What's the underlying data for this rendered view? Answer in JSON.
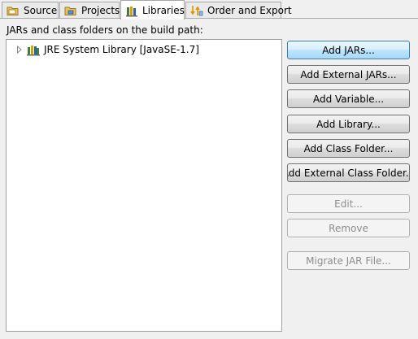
{
  "tabs": [
    {
      "label": "Source",
      "icon": "source-folder-icon",
      "active": false
    },
    {
      "label": "Projects",
      "icon": "projects-icon",
      "active": false
    },
    {
      "label": "Libraries",
      "icon": "libraries-icon",
      "active": true
    },
    {
      "label": "Order and Export",
      "icon": "order-export-icon",
      "active": false
    }
  ],
  "build_path": {
    "label": "JARs and class folders on the build path:",
    "tree": [
      {
        "label": "JRE System Library [JavaSE-1.7]",
        "icon": "jre-library-icon",
        "expanded": false
      }
    ]
  },
  "buttons": {
    "add_jars": "Add JARs...",
    "add_external_jars": "Add External JARs...",
    "add_variable": "Add Variable...",
    "add_library": "Add Library...",
    "add_class_folder": "Add Class Folder...",
    "add_external_class_folder": "Add External Class Folder...",
    "edit": "Edit...",
    "remove": "Remove",
    "migrate_jar": "Migrate JAR File..."
  },
  "colors": {
    "default_button_border": "#3c7fb1",
    "disabled_text": "#8d8d8d"
  }
}
